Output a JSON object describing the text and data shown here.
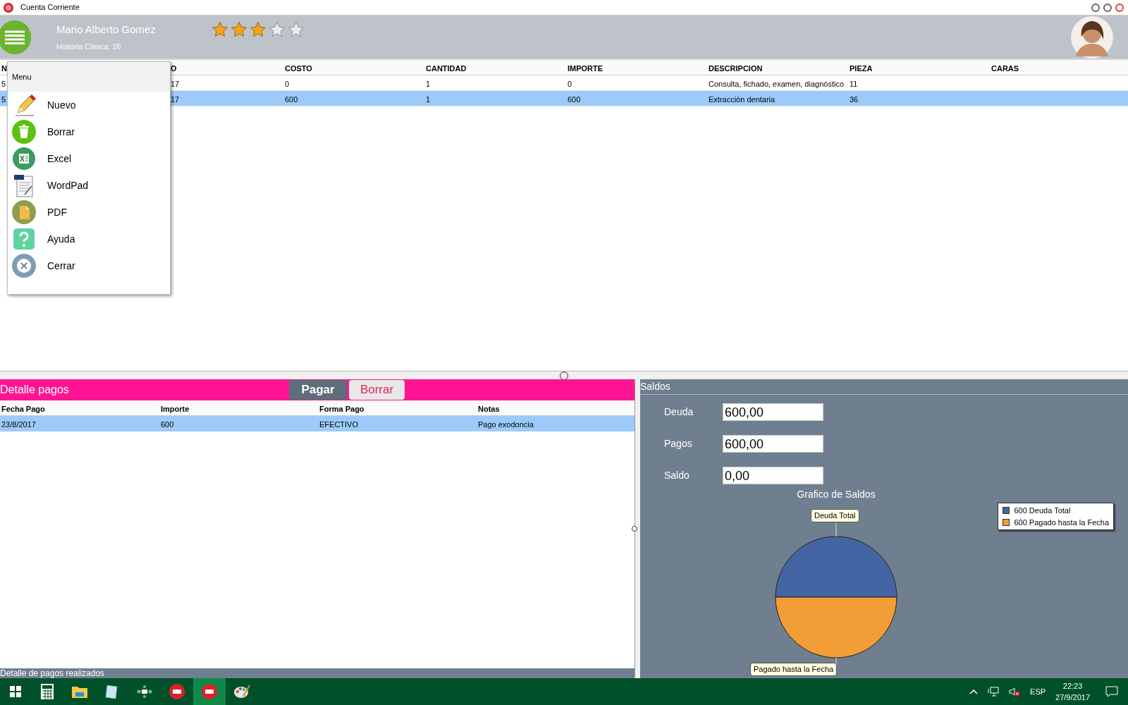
{
  "window": {
    "title": "Cuenta Corriente"
  },
  "header": {
    "patient_name": "Mario Alberto Gomez",
    "record": "Historia Clinica: 26",
    "stars": 3
  },
  "menu": {
    "title": "Menu",
    "items": [
      {
        "label": "Nuevo"
      },
      {
        "label": "Borrar"
      },
      {
        "label": "Excel"
      },
      {
        "label": "WordPad"
      },
      {
        "label": "PDF"
      },
      {
        "label": "Ayuda"
      },
      {
        "label": "Cerrar"
      }
    ]
  },
  "treatments": {
    "columns": [
      "N",
      "O",
      "COSTO",
      "CANTIDAD",
      "IMPORTE",
      "DESCRIPCION",
      "PIEZA",
      "CARAS"
    ],
    "rows": [
      {
        "selected": false,
        "cells": [
          "5",
          "17",
          "0",
          "1",
          "0",
          "Consulta, fichado, examen, diagnóstico",
          "11",
          ""
        ]
      },
      {
        "selected": true,
        "cells": [
          "5",
          "17",
          "600",
          "1",
          "600",
          "Extracción dentaria",
          "36",
          ""
        ]
      }
    ]
  },
  "payments": {
    "title": "Detalle pagos",
    "buttons": [
      "Pagar",
      "Borrar"
    ],
    "columns": [
      "Fecha Pago",
      "Importe",
      "Forma Pago",
      "Notas"
    ],
    "rows": [
      {
        "selected": true,
        "cells": [
          "23/8/2017",
          "600",
          "EFECTIVO",
          "Pago exodoncia"
        ]
      }
    ],
    "footer": "Detalle de pagos realizados"
  },
  "balances": {
    "title": "Saldos",
    "fields": [
      {
        "label": "Deuda",
        "value": "600,00"
      },
      {
        "label": "Pagos",
        "value": "600,00"
      },
      {
        "label": "Saldo",
        "value": "0,00"
      }
    ],
    "chart_data": {
      "type": "pie",
      "title": "Grafico de Saldos",
      "categories": [
        "Deuda Total",
        "Pagado hasta la Fecha"
      ],
      "values": [
        50,
        50
      ]
    },
    "legend": [
      {
        "label": "600 Deuda Total",
        "color": "#4465a3"
      },
      {
        "label": "600 Pagado hasta la Fecha",
        "color": "#f29d35"
      }
    ]
  },
  "taskbar": {
    "language": "ESP",
    "time": "22:23",
    "date": "27/9/2017"
  }
}
